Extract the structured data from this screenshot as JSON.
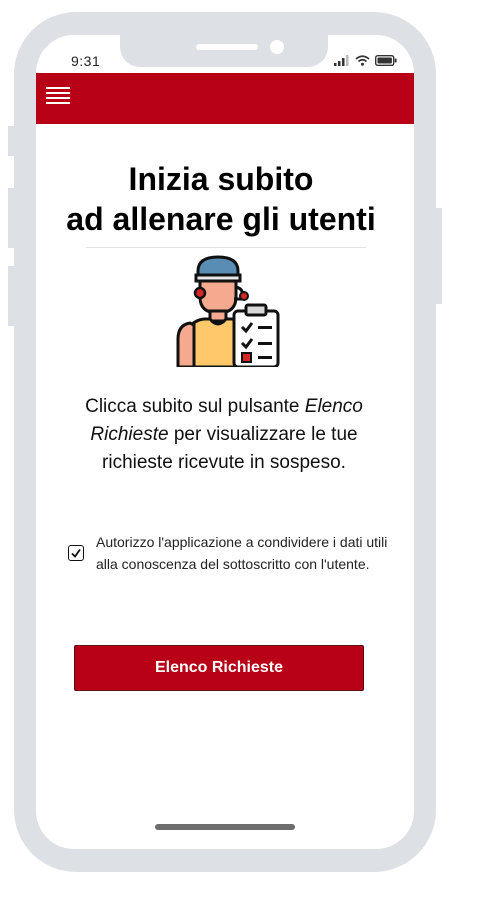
{
  "status_bar": {
    "time": "9:31"
  },
  "header": {
    "menu_icon": "hamburger-menu-icon",
    "color": "#b80017"
  },
  "hero": {
    "title_line1": "Inizia subito",
    "title_line2": "ad allenare gli utenti",
    "illustration": "trainer-clipboard-icon"
  },
  "description": {
    "part1": "Clicca subito sul pulsante ",
    "emphasis": "Elenco Richieste",
    "part2": " per visualizzare le tue richieste ricevute in sospeso."
  },
  "consent": {
    "checked": true,
    "text": "Autorizzo l'applicazione a condividere i dati utili alla conoscenza del sottoscritto con l'utente."
  },
  "cta": {
    "label": "Elenco Richieste"
  },
  "colors": {
    "brand": "#b80017",
    "frame": "#dde1e6"
  }
}
